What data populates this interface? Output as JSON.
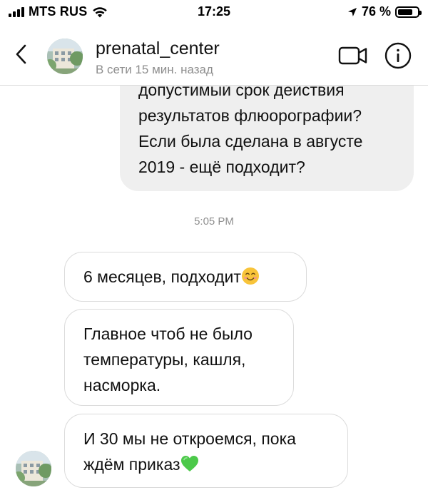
{
  "status_bar": {
    "carrier": "MTS RUS",
    "time": "17:25",
    "battery_percent": "76 %",
    "battery_level": 0.76,
    "icons": [
      "signal-icon",
      "wifi-icon",
      "location-arrow-icon",
      "battery-icon"
    ]
  },
  "header": {
    "title": "prenatal_center",
    "subtitle": "В сети 15 мин. назад",
    "icons": [
      "chevron-left-icon",
      "video-camera-icon",
      "info-icon"
    ]
  },
  "messages": {
    "sent_text": "допустимый срок действия результатов флюорографии? Если была сделана в августе 2019 - ещё подходит?",
    "timestamp": "5:05 PM",
    "received": [
      {
        "text": "6 месяцев, подходит",
        "emoji": "smiling-face-emoji"
      },
      {
        "text": "Главное чтоб не было температуры, кашля, насморка."
      },
      {
        "text": "И 30 мы не откроемся, пока ждём приказ",
        "emoji": "green-heart-emoji"
      }
    ]
  },
  "colors": {
    "sent_bubble": "#efefef",
    "received_border": "#dbdbdb",
    "secondary_text": "#8e8e8e",
    "heart": "#4cc94a",
    "smile": "#f8c43a"
  }
}
